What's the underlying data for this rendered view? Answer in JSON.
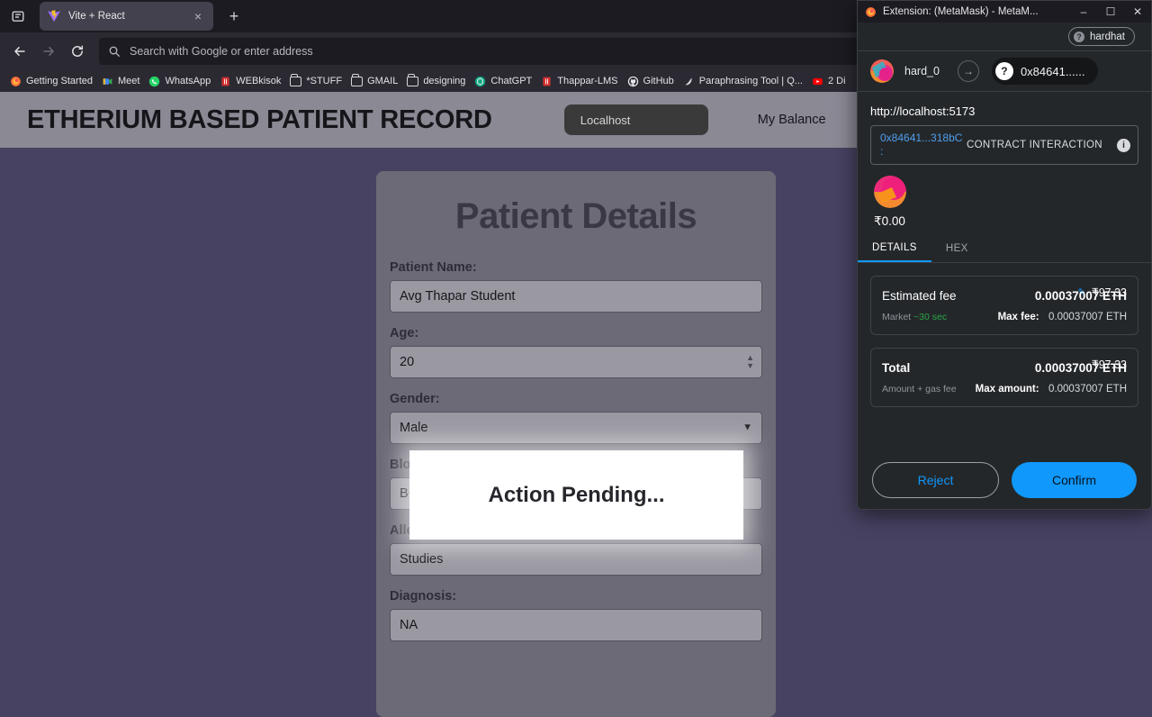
{
  "browser": {
    "tab": {
      "title": "Vite + React",
      "favicon": "vite-logo-icon",
      "close_label": "×"
    },
    "new_tab_label": "+",
    "list_all_tabs": "list-all-tabs-icon",
    "nav": {
      "back": "back-arrow-icon",
      "forward": "forward-arrow-icon",
      "reload": "reload-icon"
    },
    "urlbar": {
      "placeholder": "Search with Google or enter address",
      "value": "",
      "search_icon": "search-icon"
    },
    "bookmarks": [
      {
        "label": "Getting Started",
        "icon": "firefox-icon"
      },
      {
        "label": "Meet",
        "icon": "google-meet-icon"
      },
      {
        "label": "WhatsApp",
        "icon": "whatsapp-icon"
      },
      {
        "label": "WEBkisok",
        "icon": "webkiosk-icon"
      },
      {
        "label": "*STUFF",
        "icon": "folder-icon"
      },
      {
        "label": "GMAIL",
        "icon": "folder-icon"
      },
      {
        "label": "designing",
        "icon": "folder-icon"
      },
      {
        "label": "ChatGPT",
        "icon": "chatgpt-icon"
      },
      {
        "label": "Thappar-LMS",
        "icon": "lms-icon"
      },
      {
        "label": "GitHub",
        "icon": "github-icon"
      },
      {
        "label": "Paraphrasing Tool | Q...",
        "icon": "quillbot-icon"
      },
      {
        "label": "2 Di",
        "icon": "youtube-icon"
      }
    ]
  },
  "page": {
    "site_title": "ETHERIUM BASED PATIENT RECORD",
    "network_button": "Localhost",
    "balance_label": "My Balance",
    "card_title": "Patient Details",
    "fields": [
      {
        "label": "Patient Name:",
        "value": "Avg Thapar Student",
        "type": "text"
      },
      {
        "label": "Age:",
        "value": "20",
        "type": "number"
      },
      {
        "label": "Gender:",
        "value": "Male",
        "type": "select"
      },
      {
        "label": "Blood type:",
        "value": "B+",
        "type": "text"
      },
      {
        "label": "Allergies:",
        "value": "Studies",
        "type": "text"
      },
      {
        "label": "Diagnosis:",
        "value": "NA",
        "type": "text"
      }
    ],
    "modal": {
      "text": "Action Pending..."
    }
  },
  "metamask": {
    "window_title": "Extension: (MetaMask) - MetaM...",
    "window_controls": {
      "minimize": "–",
      "maximize": "☐",
      "close": "✕"
    },
    "network": {
      "name": "hardhat",
      "badge": "?"
    },
    "account": {
      "name": "hard_0",
      "avatar": "jazzicon-avatar"
    },
    "recipient": {
      "address": "0x84641......",
      "badge": "?"
    },
    "origin": "http://localhost:5173",
    "contract": {
      "address": "0x84641...318bC :",
      "type": "CONTRACT INTERACTION",
      "info_icon": "info-icon"
    },
    "amount": {
      "token_icon": "eth-token-icon",
      "fiat": "₹0.00"
    },
    "tabs": [
      {
        "label": "DETAILS",
        "active": true
      },
      {
        "label": "HEX",
        "active": false
      }
    ],
    "estimated_fee": {
      "edit_icon": "pencil-icon",
      "fiat": "₹97.33",
      "label": "Estimated fee",
      "eth": "0.00037007 ETH",
      "market_prefix": "Market",
      "market_time": "~30 sec",
      "max_label": "Max fee:",
      "max_value": "0.00037007 ETH"
    },
    "total": {
      "fiat": "₹97.33",
      "label": "Total",
      "eth": "0.00037007 ETH",
      "sub_label": "Amount + gas fee",
      "max_label": "Max amount:",
      "max_value": "0.00037007 ETH"
    },
    "buttons": {
      "reject": "Reject",
      "confirm": "Confirm"
    }
  },
  "colors": {
    "page_bg": "#474261",
    "header_bg": "#8b8994",
    "card_bg": "#6b6a76",
    "input_bg": "#9a99a2",
    "mm_bg": "#24272a",
    "accent_blue": "#1098fc",
    "market_green": "#28a745"
  }
}
